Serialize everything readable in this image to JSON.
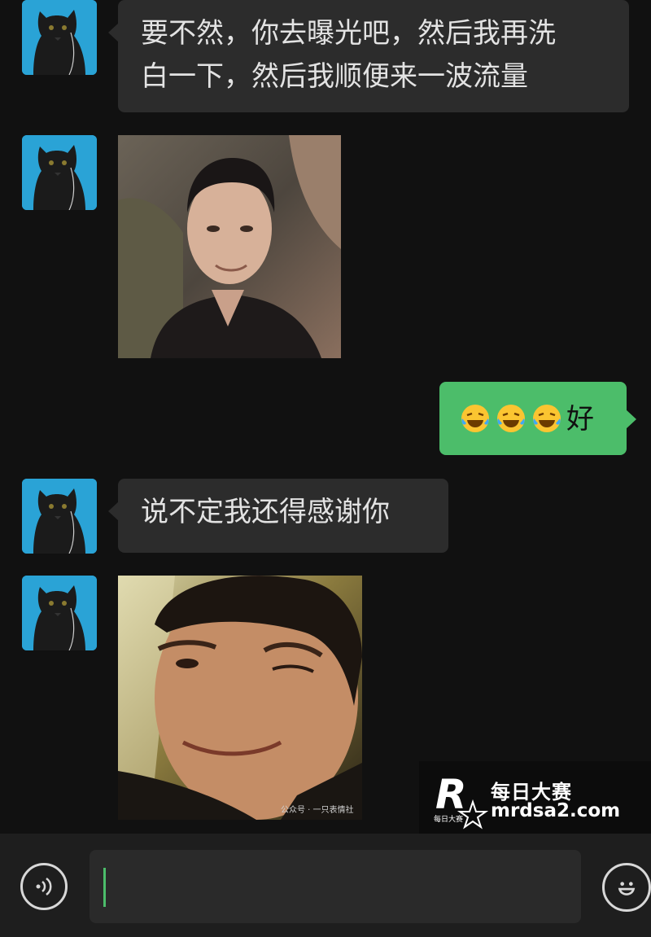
{
  "messages": [
    {
      "side": "left",
      "type": "text",
      "lines": [
        "要不然，你去曝光吧，然后我再洗",
        "白一下，然后我顺便来一波流量"
      ]
    },
    {
      "side": "left",
      "type": "image",
      "subject": "man-smiling-photo"
    },
    {
      "side": "right",
      "type": "text",
      "emoji": [
        "face-with-tears-of-joy",
        "face-with-tears-of-joy",
        "face-with-tears-of-joy"
      ],
      "text": "好"
    },
    {
      "side": "left",
      "type": "text",
      "lines": [
        "说不定我还得感谢你"
      ]
    },
    {
      "side": "left",
      "type": "image",
      "subject": "man-winking-photo",
      "caption": "公众号 · 一只表情社"
    }
  ],
  "watermark": {
    "name": "每日大赛",
    "url": "mrdsa2.com",
    "logo_letter": "R",
    "logo_sub": "每日大赛"
  },
  "input_bar": {
    "voice_icon": "voice-wave-icon",
    "emoji_icon": "smiley-icon",
    "value": ""
  },
  "colors": {
    "background": "#111111",
    "bubble_in": "#2c2c2c",
    "bubble_out": "#4cbd6a",
    "caret": "#4cbd6a"
  }
}
